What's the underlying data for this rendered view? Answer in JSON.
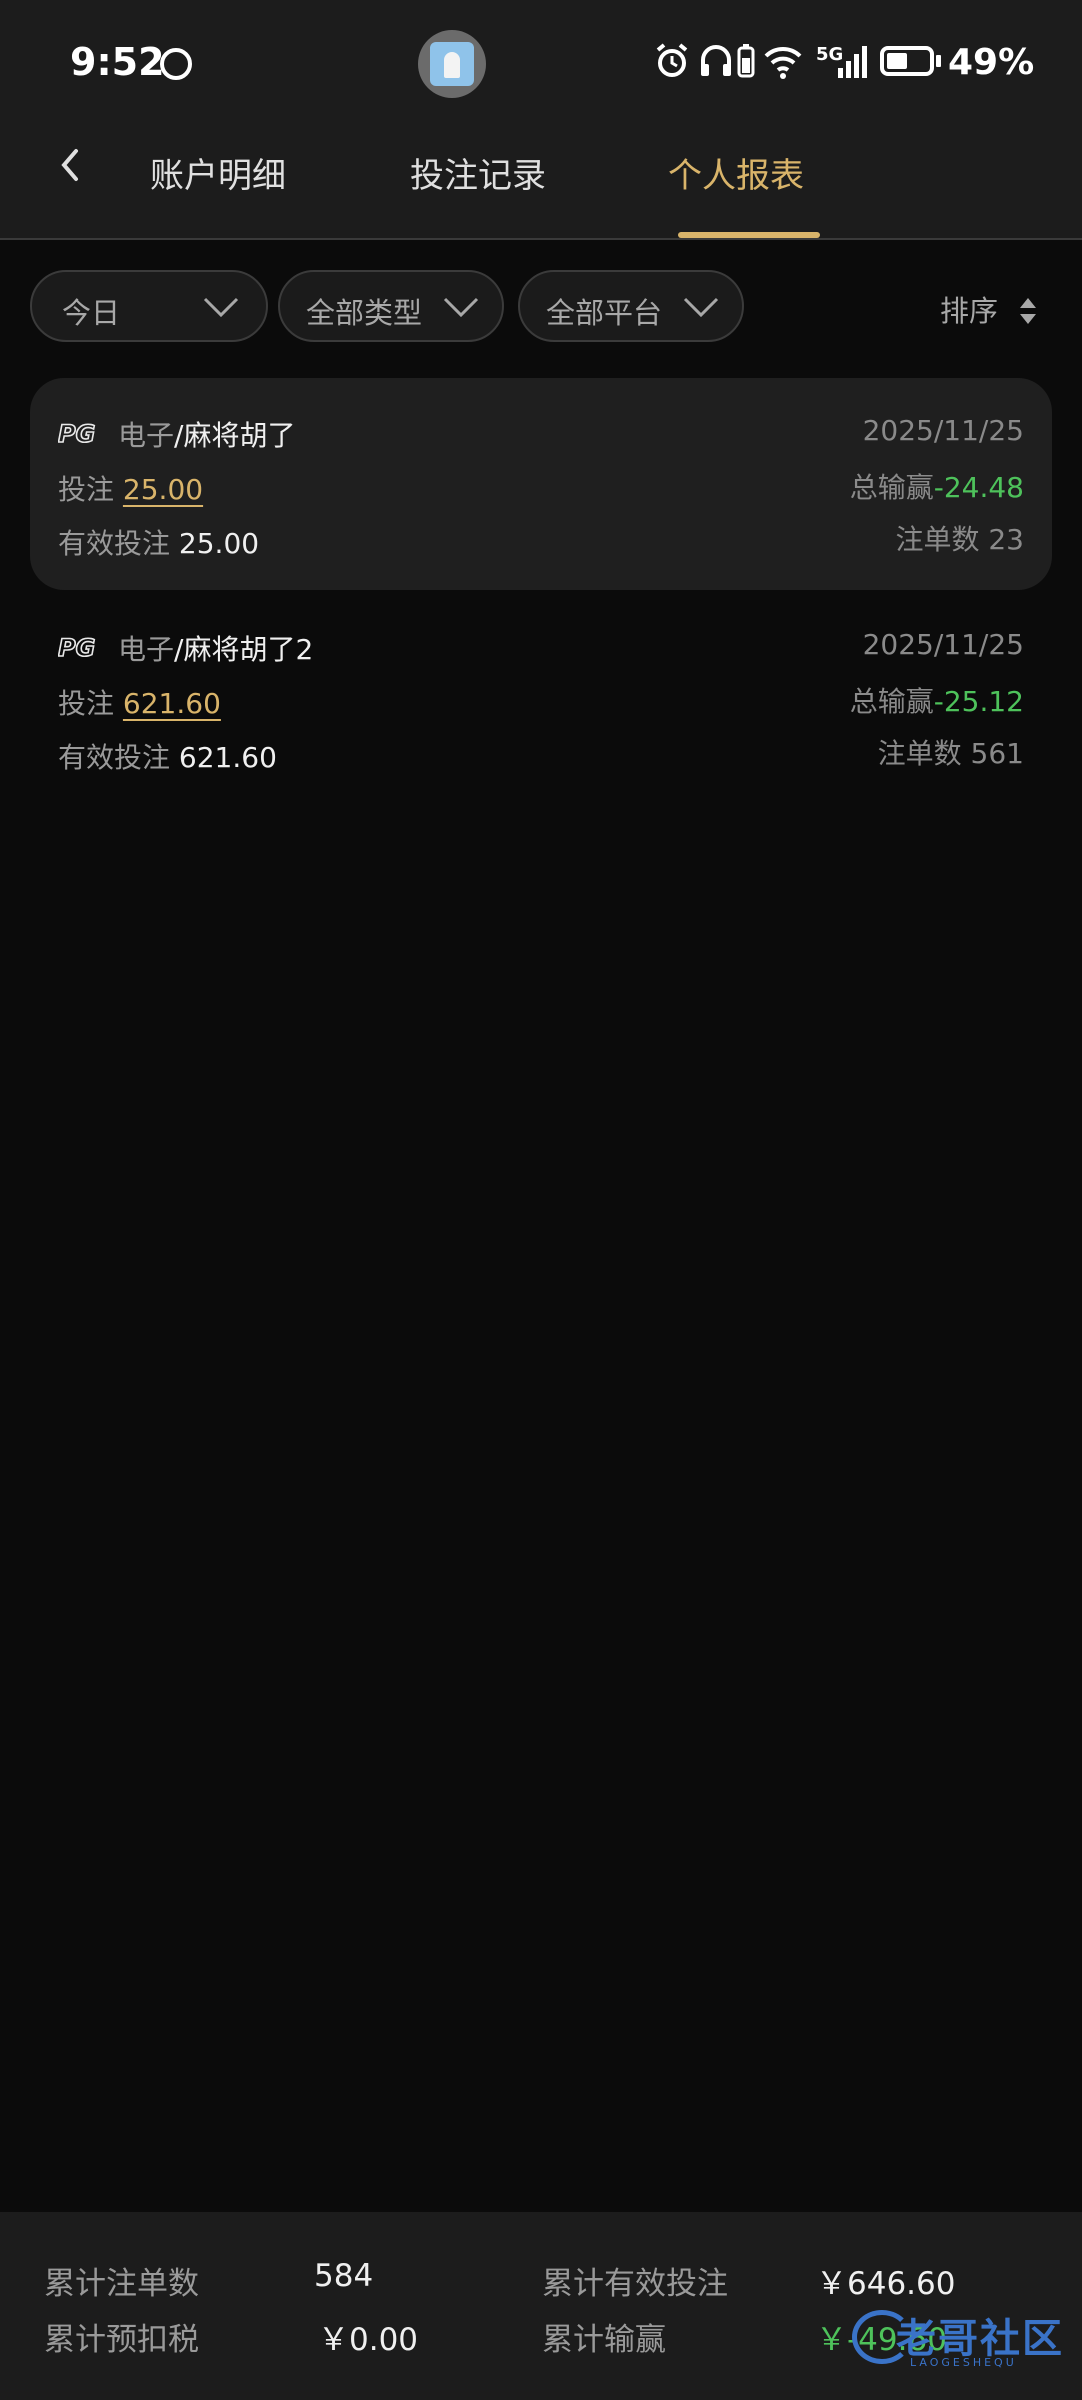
{
  "status_bar": {
    "time": "9:52",
    "network": "5G",
    "battery_percent": "49%",
    "battery_level": 0.49
  },
  "nav": {
    "tabs": [
      {
        "label": "账户明细"
      },
      {
        "label": "投注记录"
      },
      {
        "label": "个人报表"
      }
    ],
    "active_tab_index": 2
  },
  "filters": {
    "date": "今日",
    "type": "全部类型",
    "platform": "全部平台",
    "sort_label": "排序"
  },
  "records": [
    {
      "platform_logo": "PG",
      "category": "电子",
      "game": "/麻将胡了",
      "bet_label": "投注",
      "bet": "25.00",
      "valid_label": "有效投注",
      "valid_bet": "25.00",
      "date": "2025/11/25",
      "pl_label": "总输赢",
      "pl_value": "-24.48",
      "count_label": "注单数",
      "count": "23"
    },
    {
      "platform_logo": "PG",
      "category": "电子",
      "game": "/麻将胡了2",
      "bet_label": "投注",
      "bet": "621.60",
      "valid_label": "有效投注",
      "valid_bet": "621.60",
      "date": "2025/11/25",
      "pl_label": "总输赢",
      "pl_value": "-25.12",
      "count_label": "注单数",
      "count": "561"
    }
  ],
  "summary": {
    "total_orders_label": "累计注单数",
    "total_orders": "584",
    "total_valid_label": "累计有效投注",
    "total_valid": "￥646.60",
    "tax_label": "累计预扣税",
    "tax": "￥0.00",
    "total_pl_label": "累计输赢",
    "total_pl": "￥-49.60"
  },
  "watermark": {
    "text": "老哥社区",
    "sub": "LAOGESHEQU"
  },
  "colors": {
    "accent": "#d9b46a",
    "win_loss": "#4ec25b",
    "background": "#0b0b0b"
  }
}
